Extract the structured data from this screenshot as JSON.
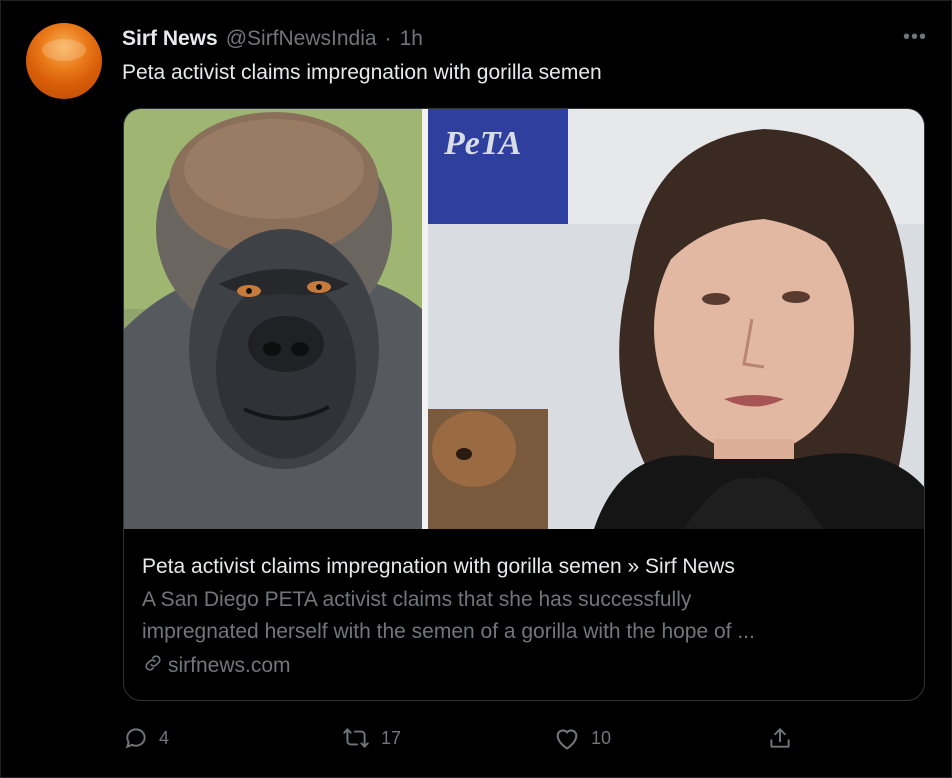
{
  "tweet": {
    "author_name": "Sirf News",
    "handle": "@SirfNewsIndia",
    "separator": "·",
    "time": "1h",
    "more_label": "•••",
    "text": "Peta activist claims impregnation with gorilla semen"
  },
  "card": {
    "image_logo_text": "PeTA",
    "title": "Peta activist claims impregnation with gorilla semen » Sirf News",
    "description_line1": "A San Diego PETA activist claims that she has successfully",
    "description_line2": "impregnated herself with the semen of a gorilla with the hope of ...",
    "domain": "sirfnews.com"
  },
  "actions": {
    "reply_count": "4",
    "retweet_count": "17",
    "like_count": "10"
  },
  "icons": {
    "reply": "reply-icon",
    "retweet": "retweet-icon",
    "like": "heart-icon",
    "share": "share-icon",
    "link": "link-icon",
    "more": "more-icon"
  },
  "colors": {
    "background": "#000000",
    "primary_text": "#e7e9ea",
    "secondary_text": "#71767b",
    "border": "#2f3336",
    "avatar": "#e8751a",
    "peta_blue": "#2e3f9e"
  }
}
